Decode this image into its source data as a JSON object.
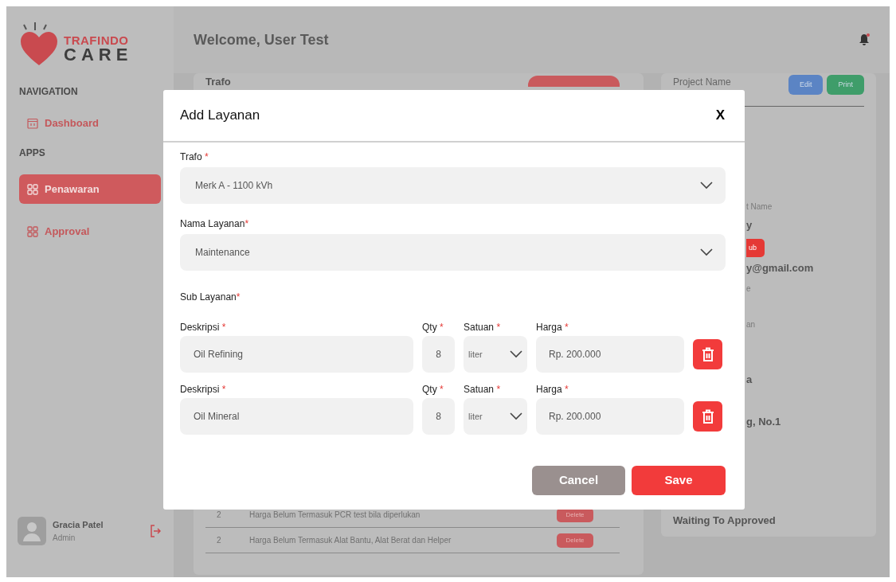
{
  "sidebar": {
    "logo": {
      "line1": "TRAFINDO",
      "line2": "CARE"
    },
    "sections": [
      {
        "heading": "NAVIGATION",
        "items": [
          {
            "label": "Dashboard",
            "kind": "calendar",
            "selected": false
          }
        ]
      },
      {
        "heading": "APPS",
        "items": [
          {
            "label": "Penawaran",
            "kind": "grid",
            "selected": true
          },
          {
            "label": "Approval",
            "kind": "grid",
            "selected": false
          }
        ]
      }
    ],
    "user": {
      "name": "Gracia Patel",
      "role": "Admin"
    }
  },
  "header": {
    "title": "Welcome, User Test"
  },
  "trafo_card": {
    "title": "Trafo",
    "rows": [
      {
        "number": "2",
        "description": "Harga Belum Termasuk PCR test bila diperlukan",
        "action": "Delete"
      },
      {
        "number": "2",
        "description": "Harga Belum Termasuk Alat Bantu, Alat Berat dan Helper",
        "action": "Delete"
      }
    ]
  },
  "project_card": {
    "title": "Project Name",
    "buttons": [
      {
        "label": "Edit",
        "kind": "edit"
      },
      {
        "label": "Print",
        "kind": "print"
      }
    ],
    "fragments": [
      {
        "text": "t Name",
        "kind": "label"
      },
      {
        "text": "y",
        "kind": "value"
      },
      {
        "text": "ub",
        "kind": "badge"
      },
      {
        "text": "y@gmail.com",
        "kind": "value"
      },
      {
        "text": "e",
        "kind": "label"
      },
      {
        "text": "an",
        "kind": "label"
      },
      {
        "text": "a",
        "kind": "value"
      },
      {
        "text": "g, No.1",
        "kind": "value"
      },
      {
        "text": "Waiting To Approved",
        "kind": "status"
      }
    ]
  },
  "modal": {
    "title": "Add Layanan",
    "close": "X",
    "selects": [
      {
        "label": "Trafo ",
        "required": "*",
        "value": "Merk A - 1100 kVh"
      },
      {
        "label": "Nama Layanan",
        "required": "*",
        "value": "Maintenance"
      }
    ],
    "sub_heading": {
      "label": "Sub Layanan",
      "required": "*"
    },
    "sub_items": [
      {
        "deskripsi_label": "Deskripsi ",
        "qty_label": "Qty ",
        "satuan_label": "Satuan ",
        "harga_label": "Harga ",
        "required": "*",
        "deskripsi": "Oil Refining",
        "qty": "8",
        "satuan": "liter",
        "harga": "Rp. 200.000"
      },
      {
        "deskripsi_label": "Deskripsi ",
        "qty_label": "Qty ",
        "satuan_label": "Satuan ",
        "harga_label": "Harga ",
        "required": "*",
        "deskripsi": "Oil Mineral",
        "qty": "8",
        "satuan": "liter",
        "harga": "Rp. 200.000"
      }
    ],
    "buttons": [
      {
        "label": "Cancel",
        "kind": "cancel"
      },
      {
        "label": "Save",
        "kind": "save"
      }
    ]
  }
}
